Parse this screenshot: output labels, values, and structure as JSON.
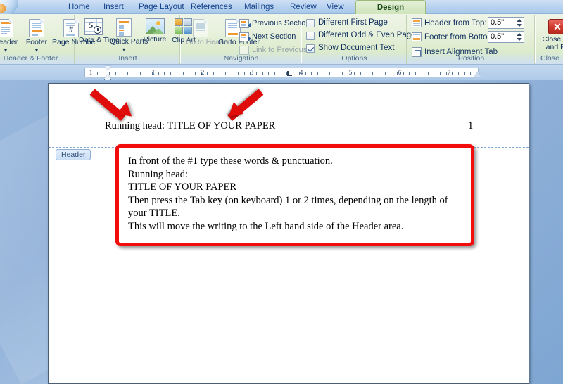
{
  "tabs": [
    {
      "label": "Home",
      "active": false
    },
    {
      "label": "Insert",
      "active": false
    },
    {
      "label": "Page Layout",
      "active": false
    },
    {
      "label": "References",
      "active": false
    },
    {
      "label": "Mailings",
      "active": false
    },
    {
      "label": "Review",
      "active": false
    },
    {
      "label": "View",
      "active": false
    },
    {
      "label": "Design",
      "active": true
    }
  ],
  "ribbon": {
    "groups": {
      "header_footer": {
        "label": "Header & Footer",
        "buttons": [
          {
            "label": "Header",
            "dropdown": true
          },
          {
            "label": "Footer",
            "dropdown": true
          },
          {
            "label": "Page Number",
            "dropdown": true
          }
        ]
      },
      "insert": {
        "label": "Insert",
        "buttons": [
          {
            "label": "Date & Time",
            "dropdown": false
          },
          {
            "label": "Quick Parts",
            "dropdown": true
          },
          {
            "label": "Picture",
            "dropdown": false
          },
          {
            "label": "Clip Art",
            "dropdown": false
          }
        ]
      },
      "navigation": {
        "label": "Navigation",
        "big_buttons": [
          {
            "label": "Go to Header",
            "enabled": false
          },
          {
            "label": "Go to Footer",
            "enabled": true
          }
        ],
        "small_buttons": [
          {
            "label": "Previous Section",
            "enabled": true
          },
          {
            "label": "Next Section",
            "enabled": true
          },
          {
            "label": "Link to Previous",
            "enabled": false
          }
        ]
      },
      "options": {
        "label": "Options",
        "checkboxes": [
          {
            "label": "Different First Page",
            "checked": false
          },
          {
            "label": "Different Odd & Even Pages",
            "checked": false
          },
          {
            "label": "Show Document Text",
            "checked": true
          }
        ]
      },
      "position": {
        "label": "Position",
        "header_from_top_label": "Header from Top:",
        "header_from_top_value": "0.5\"",
        "footer_from_bottom_label": "Footer from Bottom:",
        "footer_from_bottom_value": "0.5\"",
        "insert_alignment_tab_label": "Insert Alignment Tab"
      },
      "close": {
        "label": "Close",
        "button_line1": "Close He",
        "button_line2": "and Fo"
      }
    }
  },
  "ruler": {
    "numbers": [
      "1",
      "1",
      "2",
      "3",
      "4",
      "5",
      "6",
      "7"
    ],
    "unit": "inches"
  },
  "document": {
    "header_tag_label": "Header",
    "running_head": "Running head: TITLE OF YOUR PAPER",
    "page_number": "1",
    "callout_lines": [
      "In front of the #1 type these words & punctuation.",
      "Running head:",
      "TITLE OF YOUR PAPER",
      "Then press the Tab key (on keyboard) 1 or 2 times, depending on the length of your TITLE.",
      "This will move the writing to the Left hand side of the Header area."
    ]
  },
  "annotations": {
    "arrow_color": "#e00b0b",
    "callout_border_color": "#f30c0c",
    "arrows": [
      {
        "name": "arrow-to-running-head-left",
        "direction": "down-right"
      },
      {
        "name": "arrow-to-title-text",
        "direction": "down-left"
      }
    ]
  }
}
